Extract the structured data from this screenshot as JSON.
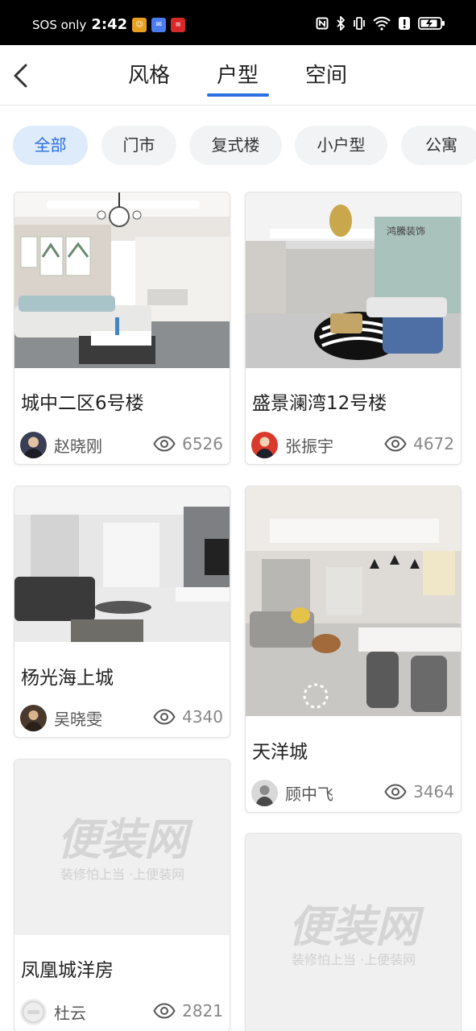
{
  "status_bar": {
    "carrier": "SOS only",
    "time": "2:42"
  },
  "header": {
    "tabs": [
      {
        "label": "风格",
        "active": false
      },
      {
        "label": "户型",
        "active": true
      },
      {
        "label": "空间",
        "active": false
      }
    ],
    "accent_color": "#2b6fe0"
  },
  "filters": [
    {
      "label": "全部",
      "active": true
    },
    {
      "label": "门市",
      "active": false
    },
    {
      "label": "复式楼",
      "active": false
    },
    {
      "label": "小户型",
      "active": false
    },
    {
      "label": "公寓",
      "active": false
    }
  ],
  "cards": [
    {
      "title": "城中二区6号楼",
      "author": "赵晓刚",
      "views": "6526"
    },
    {
      "title": "盛景澜湾12号楼",
      "author": "张振宇",
      "views": "4672",
      "image_brand": "鸿騰装饰"
    },
    {
      "title": "杨光海上城",
      "author": "吴晓雯",
      "views": "4340"
    },
    {
      "title": "天洋城",
      "author": "顾中飞",
      "views": "3464"
    },
    {
      "title": "凤凰城洋房",
      "author": "杜云",
      "views": "2821",
      "placeholder_logo": "便装网",
      "placeholder_slogan": "装修怕上当 ·上便装网"
    },
    {
      "placeholder_logo": "便装网",
      "placeholder_slogan": "装修怕上当 ·上便装网"
    }
  ]
}
